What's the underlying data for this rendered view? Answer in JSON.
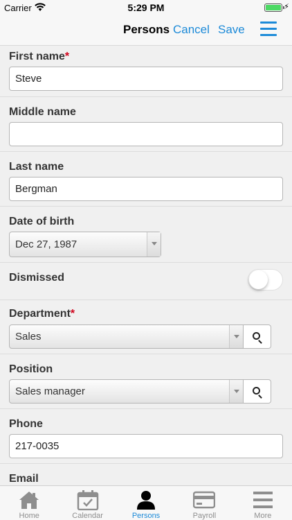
{
  "status_bar": {
    "carrier": "Carrier",
    "time": "5:29 PM"
  },
  "nav": {
    "title": "Persons",
    "cancel": "Cancel",
    "save": "Save"
  },
  "form": {
    "first_name": {
      "label": "First name",
      "required_mark": "*",
      "value": "Steve"
    },
    "middle_name": {
      "label": "Middle name",
      "value": ""
    },
    "last_name": {
      "label": "Last name",
      "value": "Bergman"
    },
    "date_of_birth": {
      "label": "Date of birth",
      "value": "Dec 27, 1987"
    },
    "dismissed": {
      "label": "Dismissed",
      "on": false
    },
    "department": {
      "label": "Department",
      "required_mark": "*",
      "value": "Sales"
    },
    "position": {
      "label": "Position",
      "value": "Sales manager"
    },
    "phone": {
      "label": "Phone",
      "value": "217-0035"
    },
    "email": {
      "label": "Email"
    }
  },
  "tabs": [
    {
      "label": "Home",
      "icon": "home-icon",
      "active": false
    },
    {
      "label": "Calendar",
      "icon": "calendar-icon",
      "active": false
    },
    {
      "label": "Persons",
      "icon": "person-icon",
      "active": true
    },
    {
      "label": "Payroll",
      "icon": "card-icon",
      "active": false
    },
    {
      "label": "More",
      "icon": "menu-icon",
      "active": false
    }
  ],
  "colors": {
    "accent": "#1c8ad8",
    "required": "#d0021b",
    "battery": "#4cd964"
  }
}
